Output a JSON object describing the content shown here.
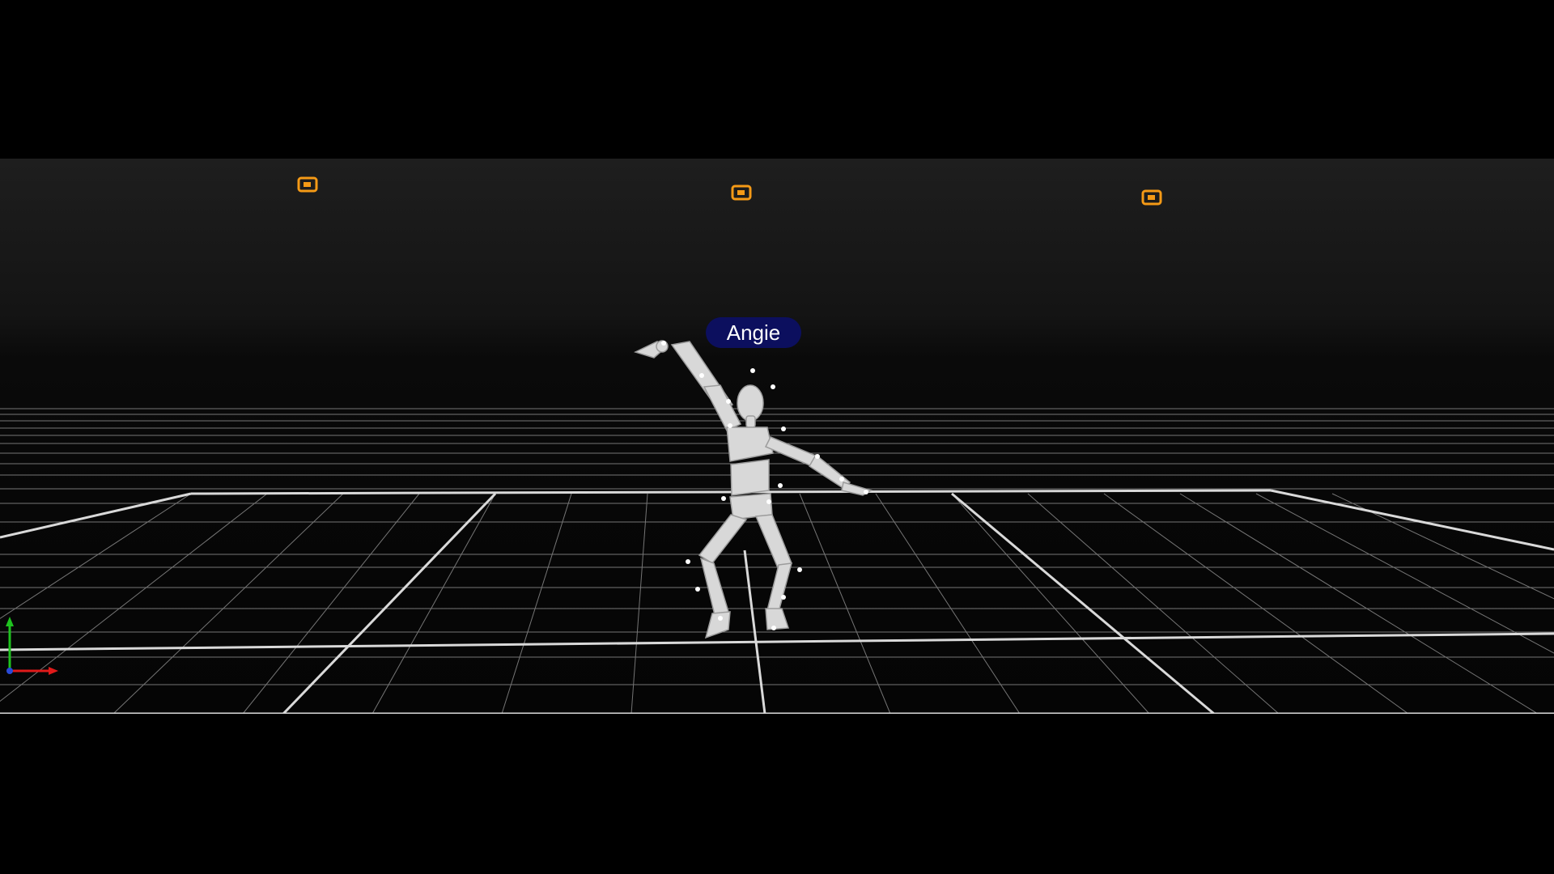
{
  "actor": {
    "name": "Angie"
  },
  "cameras": [
    {
      "id": "cam-left",
      "icon": "camera-icon"
    },
    {
      "id": "cam-center",
      "icon": "camera-icon"
    },
    {
      "id": "cam-right",
      "icon": "camera-icon"
    }
  ],
  "axis_gizmo": {
    "icon": "axis-gizmo-icon"
  },
  "colors": {
    "camera": "#f59a16",
    "label_bg": "#0c0f5e",
    "grid": "#bdbdbd",
    "axis_x": "#e01a1a",
    "axis_y": "#1fc21f",
    "axis_z": "#2a4bd8"
  }
}
